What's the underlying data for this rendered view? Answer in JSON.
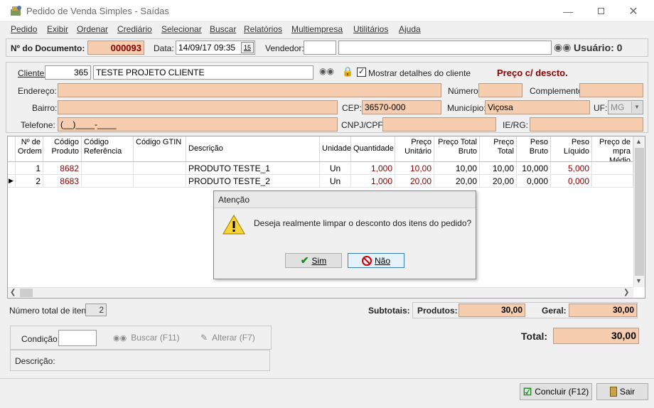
{
  "window": {
    "title": "Pedido de Venda Simples - Saídas"
  },
  "menu": [
    "Pedido",
    "Exibir",
    "Ordenar",
    "Crediário",
    "Selecionar",
    "Buscar",
    "Relatórios",
    "Multiempresa",
    "Utilitários",
    "Ajuda"
  ],
  "header": {
    "doc_label": "Nº do Documento:",
    "doc_value": "000093",
    "data_label": "Data:",
    "data_value": "14/09/17 09:35",
    "cal_label": "15",
    "vendedor_label": "Vendedor:",
    "vendedor_code": "",
    "vendedor_name": "",
    "usuario": "Usuário: 0"
  },
  "cliente": {
    "label": "Cliente:",
    "code": "365",
    "name": "TESTE PROJETO CLIENTE",
    "mostrar_label": "Mostrar detalhes do cliente",
    "mostrar_checked": true,
    "preco_label": "Preço c/ descto.",
    "endereco_label": "Endereço:",
    "endereco": "",
    "numero_label": "Número:",
    "numero": "",
    "complemento_label": "Complemento:",
    "complemento": "",
    "bairro_label": "Bairro:",
    "bairro": "",
    "cep_label": "CEP:",
    "cep": "36570-000",
    "municipio_label": "Município:",
    "municipio": "Viçosa",
    "uf_label": "UF:",
    "uf": "MG",
    "telefone_label": "Telefone:",
    "telefone": "(__)____-____",
    "cnpj_label": "CNPJ/CPF:",
    "cnpj": "",
    "ie_label": "IE/RG:",
    "ie": ""
  },
  "grid": {
    "headers": {
      "ordem": "Nº de Ordem",
      "codprod": "Código Produto",
      "codref": "Código Referência",
      "gtin": "Código GTIN",
      "descricao": "Descrição",
      "unidade": "Unidade",
      "quantidade": "Quantidade",
      "precounit": "Preço Unitário",
      "precototbruto": "Preço Total Bruto",
      "precototal": "Preço Total",
      "pesobruto": "Peso Bruto",
      "pesoliq": "Peso Líquido",
      "precomedio": "Preço de mpra Médio"
    },
    "rows": [
      {
        "ordem": "1",
        "codprod": "8682",
        "codref": "",
        "gtin": "",
        "descricao": "PRODUTO TESTE_1",
        "unidade": "Un",
        "quantidade": "1,000",
        "precounit": "10,00",
        "precototbruto": "10,00",
        "precototal": "10,00",
        "pesobruto": "10,000",
        "pesoliq": "5,000",
        "precomedio": ""
      },
      {
        "ordem": "2",
        "codprod": "8683",
        "codref": "",
        "gtin": "",
        "descricao": "PRODUTO TESTE_2",
        "unidade": "Un",
        "quantidade": "1,000",
        "precounit": "20,00",
        "precototbruto": "20,00",
        "precototal": "20,00",
        "pesobruto": "0,000",
        "pesoliq": "0,000",
        "precomedio": ""
      }
    ]
  },
  "dialog": {
    "title": "Atenção",
    "message": "Deseja realmente limpar o desconto dos itens do pedido?",
    "sim": "Sim",
    "nao": "Não"
  },
  "footer": {
    "total_itens_label": "Número total de itens:",
    "total_itens": "2",
    "subtotais_label": "Subtotais:",
    "produtos_label": "Produtos:",
    "produtos": "30,00",
    "geral_label": "Geral:",
    "geral": "30,00",
    "condicao_label": "Condição:",
    "condicao": "",
    "buscar_label": "Buscar (F11)",
    "alterar_label": "Alterar (F7)",
    "descricao_label": "Descrição:",
    "total_label": "Total:",
    "total": "30,00",
    "concluir_label": "Concluir (F12)",
    "sair_label": "Sair"
  }
}
